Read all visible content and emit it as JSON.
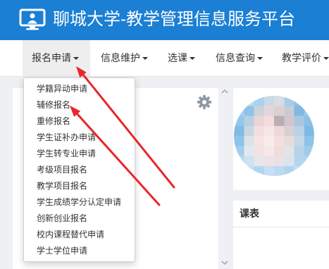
{
  "header": {
    "title": "聊城大学-教学管理信息服务平台",
    "icon": "monitor-user-icon"
  },
  "nav": {
    "items": [
      {
        "label": "报名申请",
        "active": true,
        "icon": "caret-down-icon"
      },
      {
        "label": "信息维护",
        "active": false,
        "icon": "caret-down-icon"
      },
      {
        "label": "选课",
        "active": false,
        "icon": "caret-down-icon"
      },
      {
        "label": "信息查询",
        "active": false,
        "icon": "caret-down-icon"
      },
      {
        "label": "教学评价",
        "active": false,
        "icon": "caret-down-icon"
      }
    ]
  },
  "dropdown": {
    "items": [
      "学籍异动申请",
      "辅修报名",
      "重修报名",
      "学生证补办申请",
      "学生转专业申请",
      "考级项目报名",
      "教学项目报名",
      "学生成绩学分认定申请",
      "创新创业报名",
      "校内课程替代申请",
      "学士学位申请"
    ]
  },
  "panels": {
    "left": {
      "settings_icon": "gear-icon"
    },
    "profile": {
      "avatar": "blurred-user-photo"
    },
    "schedule": {
      "title": "课表"
    }
  },
  "colors": {
    "header_bg": "#1b7fd3",
    "nav_active_bg": "#eeeeee",
    "annotation_arrow": "#e8262b"
  }
}
